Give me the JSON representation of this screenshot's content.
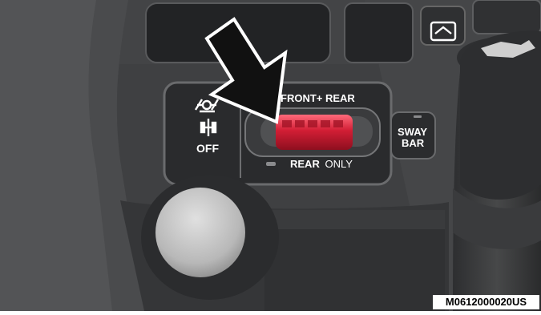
{
  "figure_code": "M0612000020US",
  "labels": {
    "off": "OFF",
    "front_rear": "FRONT+ REAR",
    "rear_only_strong": "REAR",
    "rear_only_light": "ONLY",
    "sway_bar_line1": "SWAY",
    "sway_bar_line2": "BAR"
  },
  "icons": {
    "locker_off": "axle-locker-off-icon",
    "hazard": "window-defrost-icon",
    "arrow": "pointer-arrow-icon"
  },
  "colors": {
    "panel": "#2a2b2d",
    "console": "#3d3e40",
    "switch_red": "#d21e35",
    "arrow": "#111111"
  }
}
